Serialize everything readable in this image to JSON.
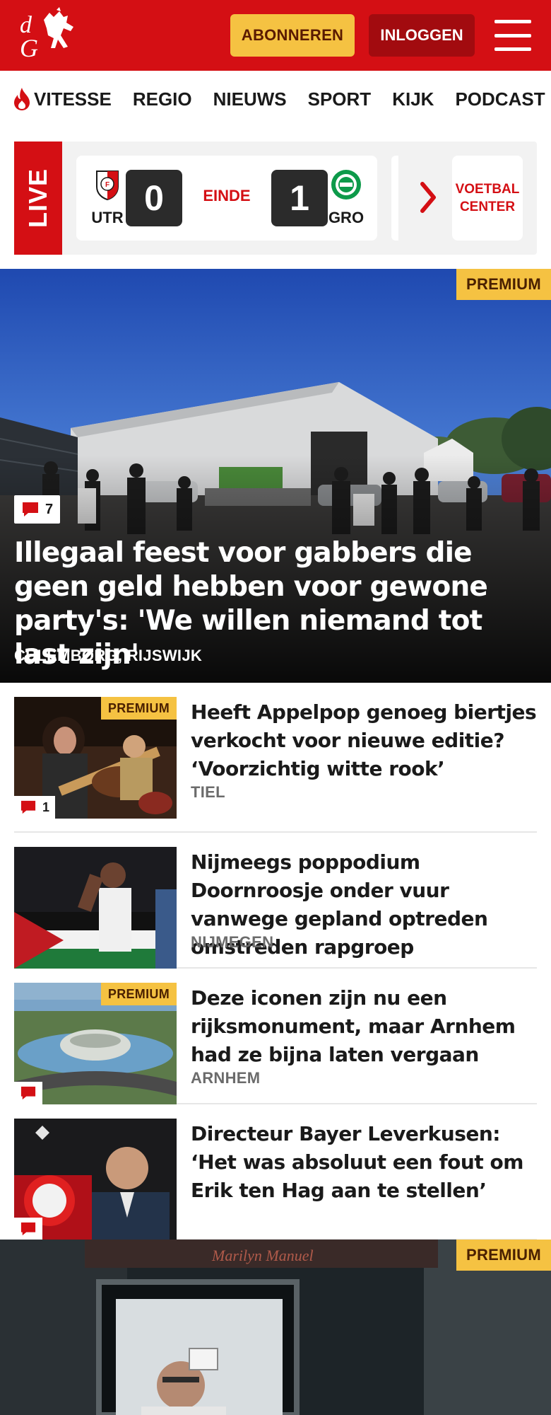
{
  "header": {
    "logo_text": "dG",
    "subscribe_label": "ABONNEREN",
    "login_label": "INLOGGEN",
    "colors": {
      "brand": "#d40f14",
      "subscribe": "#f5c242",
      "login": "#a20b0f"
    }
  },
  "nav": {
    "items": [
      {
        "label": "VITESSE",
        "icon": "flame-icon"
      },
      {
        "label": "REGIO"
      },
      {
        "label": "NIEUWS"
      },
      {
        "label": "SPORT"
      },
      {
        "label": "KIJK"
      },
      {
        "label": "PODCAST"
      }
    ]
  },
  "live": {
    "label": "LIVE",
    "match": {
      "home_abbr": "UTR",
      "home_score": "0",
      "status": "EINDE",
      "away_score": "1",
      "away_abbr": "GRO"
    },
    "voetbal_center": "VOETBAL CENTER"
  },
  "hero": {
    "badge": "PREMIUM",
    "comments": "7",
    "title": "Illegaal feest voor gabbers die geen geld hebben voor gewone party's: 'We willen niemand tot last zijn'",
    "location": "CULEMBORG, RIJSWIJK"
  },
  "articles": [
    {
      "title": "Heeft Appelpop genoeg biertjes verkocht voor nieuwe editie? ‘Voorzichtig witte rook’",
      "location": "TIEL",
      "badge": "PREMIUM",
      "comments": "1"
    },
    {
      "title": "Nijmeegs poppodium Doornroos­je onder vuur vanwege gepland optreden omstreden rapgroep",
      "location": "NIJMEGEN"
    },
    {
      "title": "Deze iconen zijn nu een rijksmonument, maar Arnhem had ze bijna laten vergaan",
      "location": "ARNHEM",
      "badge": "PREMIUM",
      "comments": ""
    },
    {
      "title": "Directeur Bayer Leverkusen: ‘Het was absoluut een fout om Erik ten Hag aan te stellen’",
      "location": "",
      "comments": ""
    }
  ],
  "feature": {
    "badge": "PREMIUM",
    "sign_text": "Marilyn Manuel"
  }
}
